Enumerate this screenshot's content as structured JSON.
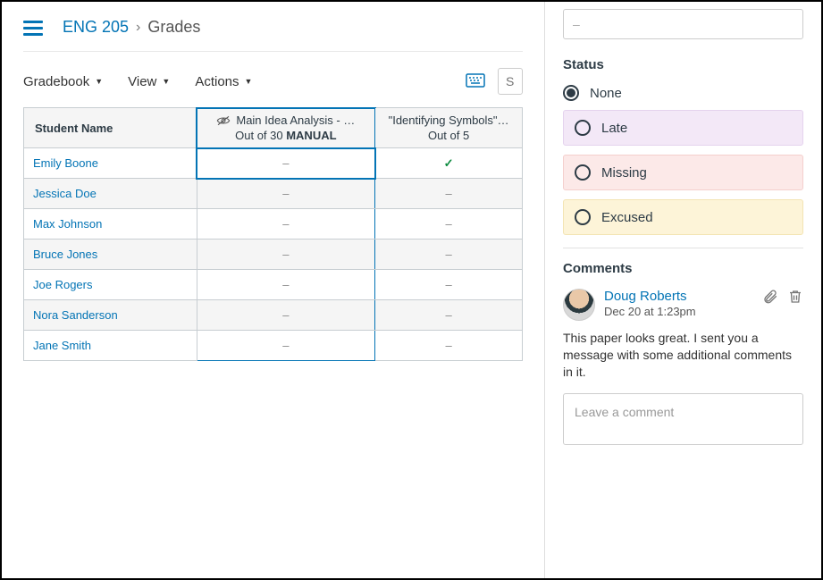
{
  "breadcrumb": {
    "course": "ENG 205",
    "page": "Grades"
  },
  "toolbar": {
    "gradebook": "Gradebook",
    "view": "View",
    "actions": "Actions",
    "search_placeholder": "Se"
  },
  "table": {
    "headers": {
      "student": "Student Name",
      "col1": {
        "title": "Main Idea Analysis - …",
        "out_of_prefix": "Out of 30 ",
        "manual": "MANUAL"
      },
      "col2": {
        "title": "\"Identifying Symbols\"…",
        "out_of": "Out of 5"
      }
    },
    "rows": [
      {
        "name": "Emily Boone",
        "c1": "–",
        "c2": "check"
      },
      {
        "name": "Jessica Doe",
        "c1": "–",
        "c2": "–"
      },
      {
        "name": "Max Johnson",
        "c1": "–",
        "c2": "–"
      },
      {
        "name": "Bruce Jones",
        "c1": "–",
        "c2": "–"
      },
      {
        "name": "Joe Rogers",
        "c1": "–",
        "c2": "–"
      },
      {
        "name": "Nora Sanderson",
        "c1": "–",
        "c2": "–"
      },
      {
        "name": "Jane Smith",
        "c1": "–",
        "c2": "–"
      }
    ]
  },
  "side": {
    "grade_value": "–",
    "status_title": "Status",
    "status_options": {
      "none": "None",
      "late": "Late",
      "missing": "Missing",
      "excused": "Excused"
    },
    "status_selected": "none",
    "comments_title": "Comments",
    "comment": {
      "author": "Doug Roberts",
      "time": "Dec 20 at 1:23pm",
      "text": "This paper looks great. I sent you a message with some additional comments in it."
    },
    "comment_placeholder": "Leave a comment"
  },
  "colors": {
    "link": "#0374b5"
  }
}
